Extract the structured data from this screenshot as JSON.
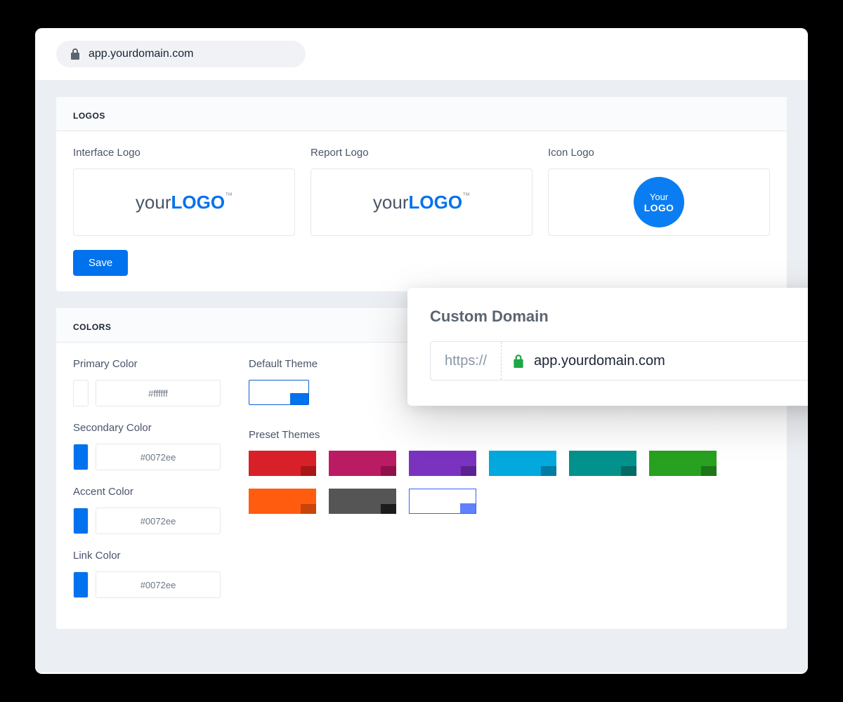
{
  "urlbar": {
    "url": "app.yourdomain.com"
  },
  "logos": {
    "section_title": "LOGOS",
    "interface_label": "Interface Logo",
    "report_label": "Report Logo",
    "icon_label": "Icon Logo",
    "logo_text_prefix": "your",
    "logo_text_bold": "LOGO",
    "logo_text_tm": "™",
    "icon_circle_line1": "Your",
    "icon_circle_line2": "LOGO",
    "save_label": "Save"
  },
  "colors": {
    "section_title": "COLORS",
    "primary": {
      "label": "Primary Color",
      "swatch": "#ffffff",
      "hex": "#ffffff"
    },
    "secondary": {
      "label": "Secondary Color",
      "swatch": "#0072ee",
      "hex": "#0072ee"
    },
    "accent": {
      "label": "Accent Color",
      "swatch": "#0072ee",
      "hex": "#0072ee"
    },
    "link": {
      "label": "Link Color",
      "swatch": "#0072ee",
      "hex": "#0072ee"
    },
    "default_theme_label": "Default Theme",
    "preset_themes_label": "Preset Themes",
    "presets": [
      {
        "main": "#d82028",
        "accent": "#a81618"
      },
      {
        "main": "#bb1b63",
        "accent": "#8e1249"
      },
      {
        "main": "#7a33bf",
        "accent": "#5a2390"
      },
      {
        "main": "#03a8dd",
        "accent": "#027ba5"
      },
      {
        "main": "#03918b",
        "accent": "#026b66"
      },
      {
        "main": "#28a020",
        "accent": "#1d7617"
      },
      {
        "main": "#ff5c10",
        "accent": "#c7450a"
      },
      {
        "main": "#555555",
        "accent": "#1c1c1c"
      },
      {
        "main": "#ffffff",
        "accent": "#6080ff",
        "outlined": true
      }
    ]
  },
  "popup": {
    "title": "Custom Domain",
    "protocol": "https://",
    "domain": "app.yourdomain.com"
  }
}
